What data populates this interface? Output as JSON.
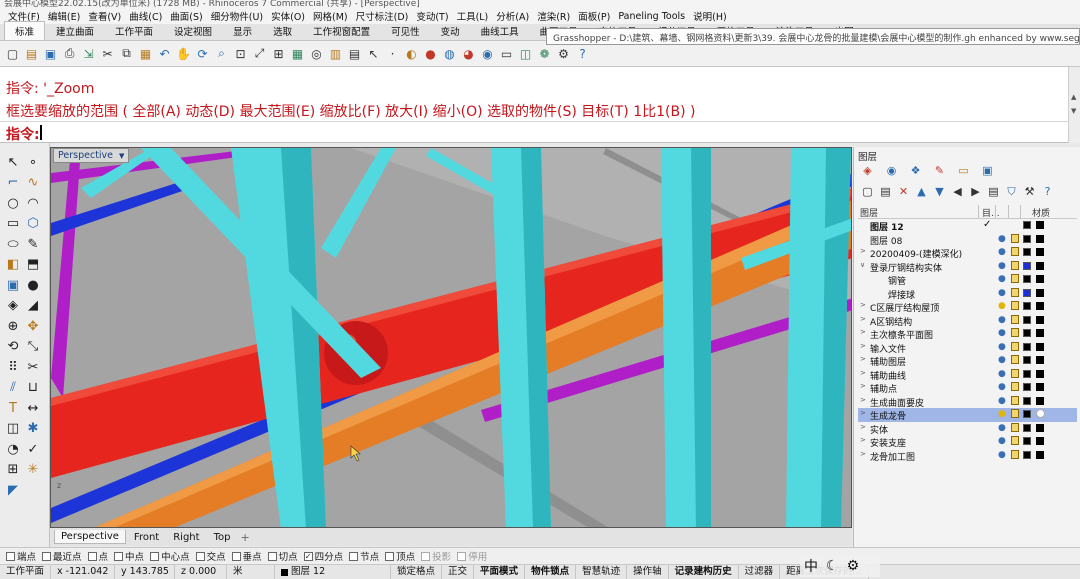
{
  "window": {
    "title": "会展中心模型22.02.15(改为单位米) (1728 MB) - Rhinoceros 7 Commercial (共享) - [Perspective]"
  },
  "menu": [
    "文件(F)",
    "编辑(E)",
    "查看(V)",
    "曲线(C)",
    "曲面(S)",
    "细分物件(U)",
    "实体(O)",
    "网格(M)",
    "尺寸标注(D)",
    "变动(T)",
    "工具(L)",
    "分析(A)",
    "渲染(R)",
    "面板(P)",
    "Paneling Tools",
    "说明(H)"
  ],
  "toolbar_tabs": [
    "标准",
    "建立曲面",
    "工作平面",
    "设定视图",
    "显示",
    "选取",
    "工作视窗配置",
    "可见性",
    "变动",
    "曲线工具",
    "曲面工具",
    "实体工具",
    "细分工具",
    "网格工具",
    "渲染工具",
    "出图"
  ],
  "toolbar_icons": [
    "new-file-icon",
    "open-folder-icon",
    "save-icon",
    "print-icon",
    "import-icon",
    "cut-icon",
    "copy-icon",
    "paste-icon",
    "undo-icon",
    "pan-hand-icon",
    "rotate-view-icon",
    "zoom-icon",
    "zoom-window-icon",
    "zoom-extents-icon",
    "zoom-selected-icon",
    "grid-view-icon",
    "camera-icon",
    "layout-icon",
    "properties-icon",
    "select-icon",
    "points-icon",
    "light-icon",
    "sphere-icon",
    "material-icon",
    "color-wheel-icon",
    "render-sphere-icon",
    "viewport-icon",
    "display-mode-icon",
    "grasshopper-icon",
    "options-icon",
    "help-icon"
  ],
  "grasshopper_tooltip": "Grasshopper - D:\\建筑、幕墙、钢网格资料\\更新3\\39. 会展中心龙骨的批量建模\\会展中心模型的制作.gh   enhanced by www.seggh.c...",
  "command": {
    "history": [
      "指令: '_Zoom",
      "框选要缩放的范围 ( 全部(A)  动态(D)  最大范围(E)  缩放比(F)  放大(I)  缩小(O)  选取的物件(S)  目标(T)  1比1(B) )"
    ],
    "prompt_label": "指令:"
  },
  "viewport": {
    "name": "Perspective",
    "tabs": [
      "Perspective",
      "Front",
      "Right",
      "Top"
    ],
    "active_tab": "Perspective",
    "add_tab": "+",
    "background": "#a4a4a4"
  },
  "left_tool_icons": [
    "select-arrow-icon",
    "point-icon",
    "polyline-icon",
    "curve-icon",
    "circle-icon",
    "arc-icon",
    "rectangle-icon",
    "polygon-icon",
    "ellipse-icon",
    "freeform-icon",
    "surface-icon",
    "extrude-icon",
    "box-icon",
    "sphere-solid-icon",
    "mesh-icon",
    "fillet-icon",
    "boolean-icon",
    "move-icon",
    "rotate-icon",
    "scale-icon",
    "array-icon",
    "trim-icon",
    "split-icon",
    "join-icon",
    "text-icon",
    "dimension-icon",
    "block-icon",
    "render-icon",
    "analyze-icon",
    "check-icon",
    "group-icon",
    "explode-icon",
    "paint-icon"
  ],
  "panel": {
    "title": "图层",
    "icons_row1": [
      "layer-icon",
      "color-icon",
      "display-icon",
      "material-icon",
      "folder-icon",
      "monitor-icon"
    ],
    "icons_row2": [
      "new-layer-icon",
      "new-sublayer-icon",
      "delete-layer-icon",
      "move-up-icon",
      "move-down-icon",
      "filter-left-icon",
      "filter-icon",
      "layer-props-icon",
      "filter-funnel-icon",
      "tools-icon",
      "help-icon"
    ],
    "headers": {
      "name": "图层",
      "current": "目...",
      "material": "材质"
    },
    "layers": [
      {
        "name": "图层 12",
        "indent": 0,
        "expand": "",
        "current": true,
        "bold": true,
        "visible": true,
        "locked": false,
        "color": "#000000",
        "material": false
      },
      {
        "name": "图层 08",
        "indent": 0,
        "expand": "",
        "current": false,
        "bold": false,
        "visible": true,
        "locked": true,
        "color": "#000000",
        "material": true
      },
      {
        "name": "20200409-(建模深化)",
        "indent": 0,
        "expand": ">",
        "current": false,
        "bold": false,
        "visible": true,
        "locked": true,
        "color": "#000000",
        "material": true
      },
      {
        "name": "登录厅钢结构实体",
        "indent": 0,
        "expand": "v",
        "current": false,
        "bold": false,
        "visible": true,
        "locked": true,
        "color": "#1a2fd9",
        "material": true
      },
      {
        "name": "钢管",
        "indent": 1,
        "expand": "",
        "current": false,
        "bold": false,
        "visible": true,
        "locked": true,
        "color": "#000000",
        "material": true
      },
      {
        "name": "焊接球",
        "indent": 1,
        "expand": "",
        "current": false,
        "bold": false,
        "visible": true,
        "locked": true,
        "color": "#1a2fd9",
        "material": true
      },
      {
        "name": "C区展厅结构屋顶",
        "indent": 0,
        "expand": ">",
        "current": false,
        "bold": false,
        "visible": true,
        "locked": true,
        "color": "#000000",
        "material": true
      },
      {
        "name": "A区钢结构",
        "indent": 0,
        "expand": ">",
        "current": false,
        "bold": false,
        "visible": true,
        "locked": true,
        "color": "#000000",
        "material": true
      },
      {
        "name": "主次檩条平面图",
        "indent": 0,
        "expand": ">",
        "current": false,
        "bold": false,
        "visible": true,
        "locked": true,
        "color": "#000000",
        "material": true
      },
      {
        "name": "输入文件",
        "indent": 0,
        "expand": ">",
        "current": false,
        "bold": false,
        "visible": true,
        "locked": true,
        "color": "#000000",
        "material": true
      },
      {
        "name": "辅助图层",
        "indent": 0,
        "expand": ">",
        "current": false,
        "bold": false,
        "visible": true,
        "locked": true,
        "color": "#000000",
        "material": true
      },
      {
        "name": "辅助曲线",
        "indent": 0,
        "expand": ">",
        "current": false,
        "bold": false,
        "visible": true,
        "locked": true,
        "color": "#000000",
        "material": true
      },
      {
        "name": "辅助点",
        "indent": 0,
        "expand": ">",
        "current": false,
        "bold": false,
        "visible": true,
        "locked": true,
        "color": "#000000",
        "material": true
      },
      {
        "name": "生成曲面要皮",
        "indent": 0,
        "expand": ">",
        "current": false,
        "bold": false,
        "visible": true,
        "locked": true,
        "color": "#000000",
        "material": true
      },
      {
        "name": "生成龙骨",
        "indent": 0,
        "expand": ">",
        "current": false,
        "bold": false,
        "visible": true,
        "locked": true,
        "color": "#000000",
        "material": true,
        "selected": true
      },
      {
        "name": "实体",
        "indent": 0,
        "expand": ">",
        "current": false,
        "bold": false,
        "visible": true,
        "locked": true,
        "color": "#000000",
        "material": true
      },
      {
        "name": "安装支座",
        "indent": 0,
        "expand": ">",
        "current": false,
        "bold": false,
        "visible": true,
        "locked": true,
        "color": "#000000",
        "material": true
      },
      {
        "name": "龙骨加工图",
        "indent": 0,
        "expand": ">",
        "current": false,
        "bold": false,
        "visible": true,
        "locked": true,
        "color": "#000000",
        "material": true
      }
    ]
  },
  "osnaps": [
    {
      "label": "端点",
      "checked": false,
      "disabled": false
    },
    {
      "label": "最近点",
      "checked": false,
      "disabled": false
    },
    {
      "label": "点",
      "checked": false,
      "disabled": false
    },
    {
      "label": "中点",
      "checked": false,
      "disabled": false
    },
    {
      "label": "中心点",
      "checked": false,
      "disabled": false
    },
    {
      "label": "交点",
      "checked": false,
      "disabled": false
    },
    {
      "label": "垂点",
      "checked": false,
      "disabled": false
    },
    {
      "label": "切点",
      "checked": false,
      "disabled": false
    },
    {
      "label": "四分点",
      "checked": true,
      "disabled": false
    },
    {
      "label": "节点",
      "checked": false,
      "disabled": false
    },
    {
      "label": "顶点",
      "checked": false,
      "disabled": false
    },
    {
      "label": "投影",
      "checked": false,
      "disabled": true
    },
    {
      "label": "停用",
      "checked": false,
      "disabled": true
    }
  ],
  "status": {
    "plane": "工作平面",
    "x": "x -121.042",
    "y": "y 143.785",
    "z": "z 0.000",
    "unit": "米",
    "layer": "图层 12",
    "toggles": [
      "锁定格点",
      "正交",
      "平面模式",
      "物件锁点",
      "智慧轨迹",
      "操作轴",
      "记录建构历史",
      "过滤器",
      "距离上次保存的..."
    ],
    "bold_toggles": [
      "平面模式",
      "物件锁点",
      "记录建构历史"
    ]
  },
  "ime": {
    "lang": "中",
    "moon": "☾",
    "gear": "⚙"
  }
}
